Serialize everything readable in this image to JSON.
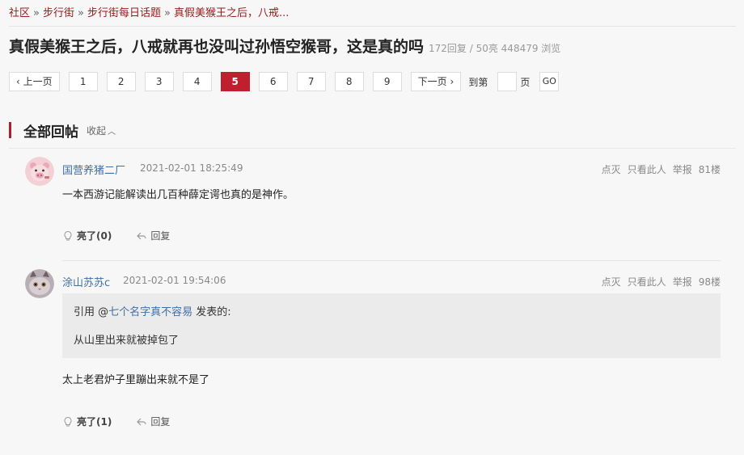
{
  "breadcrumb": {
    "items": [
      "社区",
      "步行街",
      "步行街每日话题",
      "真假美猴王之后，八戒..."
    ],
    "sep": "»"
  },
  "thread": {
    "title": "真假美猴王之后，八戒就再也没叫过孙悟空猴哥，这是真的吗",
    "meta": "172回复 / 50亮 448479 浏览"
  },
  "pager": {
    "prev": "上一页",
    "pages": [
      "1",
      "2",
      "3",
      "4",
      "5",
      "6",
      "7",
      "8",
      "9"
    ],
    "current": "5",
    "next": "下一页",
    "goto_label": "到第",
    "page_suffix": "页",
    "go": "GO"
  },
  "section": {
    "title": "全部回帖",
    "collapse": "收起"
  },
  "posts": [
    {
      "user": "国营养猪二厂",
      "time": "2021-02-01 18:25:49",
      "actions": [
        "点灭",
        "只看此人",
        "举报"
      ],
      "floor": "81楼",
      "content": "一本西游记能解读出几百种薛定谔也真的是神作。",
      "like_label": "亮了(0)",
      "reply_label": "回复",
      "avatar_icon": "pig-avatar"
    },
    {
      "user": "涂山苏苏c",
      "time": "2021-02-01 19:54:06",
      "actions": [
        "点灭",
        "只看此人",
        "举报"
      ],
      "floor": "98楼",
      "quote_prefix": "引用 @",
      "quote_user": "七个名字真不容易",
      "quote_suffix": " 发表的:",
      "quote_text": "从山里出来就被掉包了",
      "content": "太上老君炉子里蹦出来就不是了",
      "like_label": "亮了(1)",
      "reply_label": "回复",
      "avatar_icon": "cat-avatar"
    }
  ],
  "colors": {
    "accent": "#c0202e",
    "link": "#3f6fa6",
    "breadcrumb": "#9b1a1a"
  }
}
